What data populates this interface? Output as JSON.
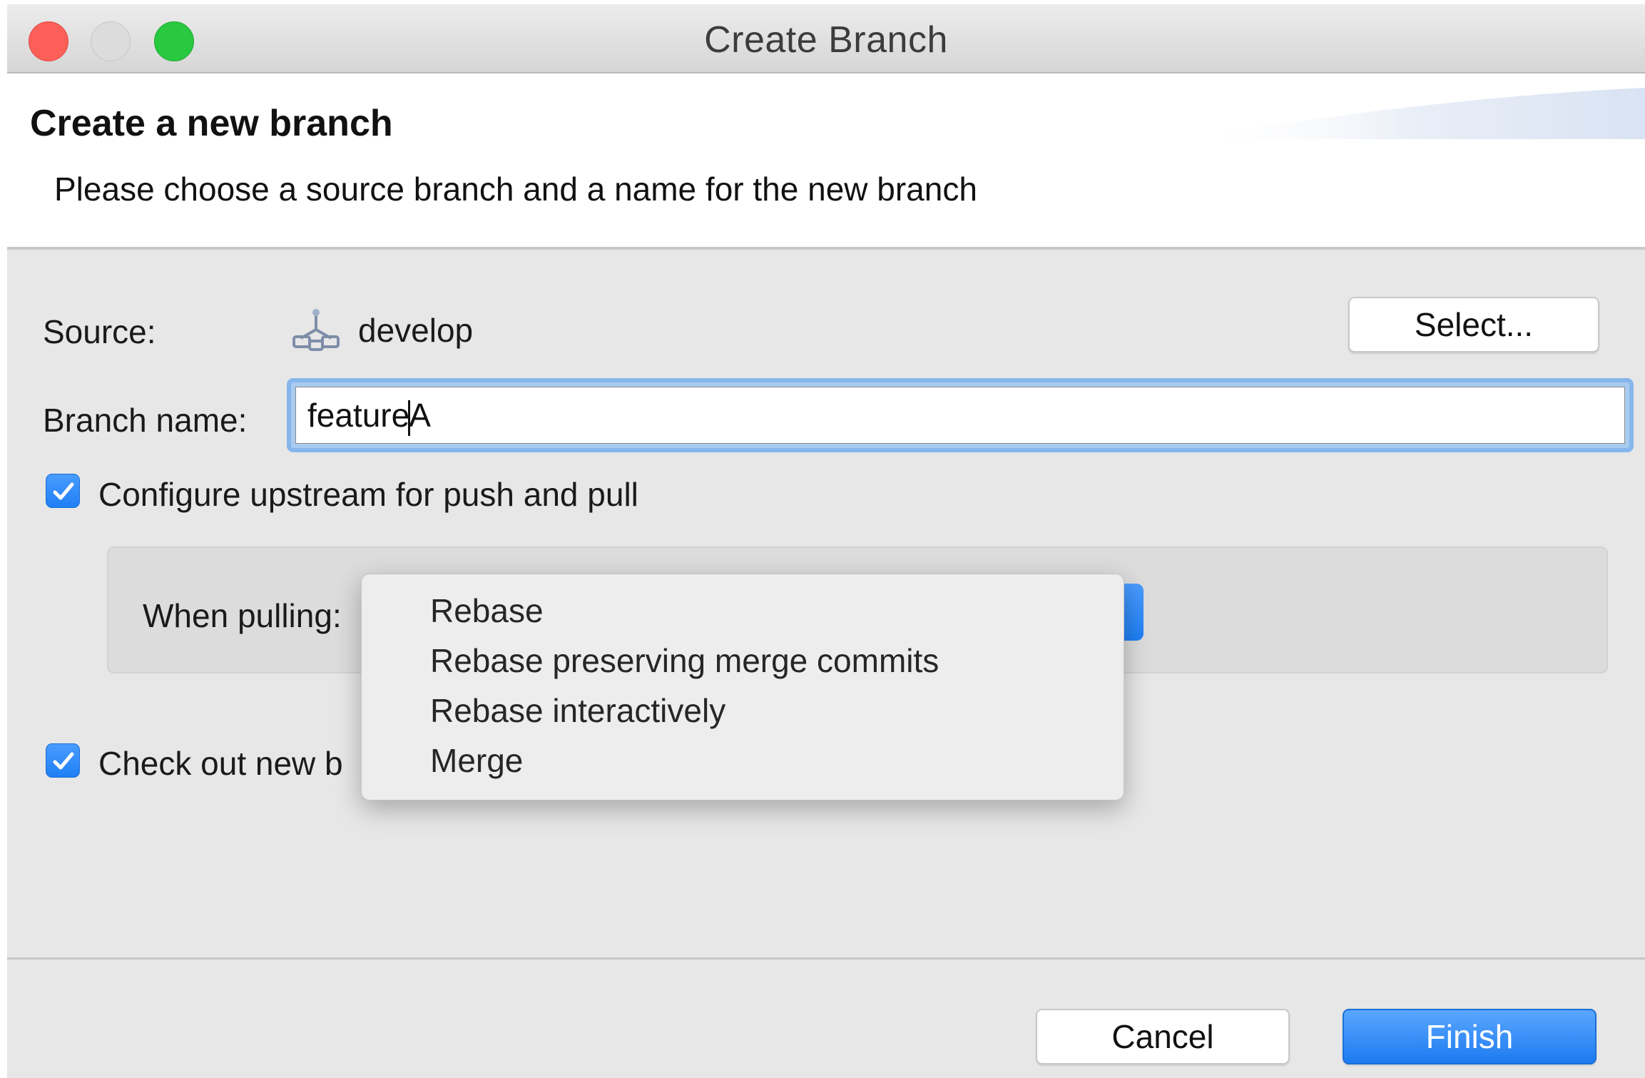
{
  "window": {
    "title": "Create Branch"
  },
  "header": {
    "title": "Create a new branch",
    "subtitle": "Please choose a source branch and a name for the new branch"
  },
  "form": {
    "source_label": "Source:",
    "source_value": "develop",
    "source_icon": "branch-icon",
    "select_button": "Select...",
    "branch_name_label": "Branch name:",
    "branch_name_before_caret": "feature",
    "branch_name_after_caret": "A",
    "configure_upstream": {
      "label": "Configure upstream for push and pull",
      "checked": true
    },
    "when_pulling_label": "When pulling:",
    "pull_options": [
      "Rebase",
      "Rebase preserving merge commits",
      "Rebase interactively",
      "Merge"
    ],
    "checkout": {
      "label": "Check out new b",
      "checked": true
    }
  },
  "footer": {
    "cancel": "Cancel",
    "finish": "Finish"
  },
  "colors": {
    "accent": "#1f7ff5",
    "close": "#fc5f57",
    "maximize": "#28c840"
  }
}
